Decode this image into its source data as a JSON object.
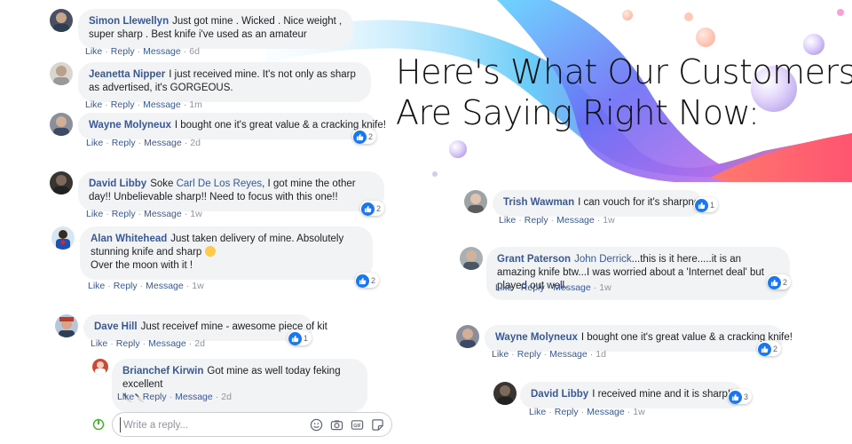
{
  "headline": {
    "line1": "Here's What Our Customers",
    "line2": "Are Saying Right Now:"
  },
  "comments": [
    {
      "name": "Simon Llewellyn",
      "text": "Just got mine . Wicked . Nice weight , super sharp . Best knife i've used as an amateur",
      "time": "6d",
      "reactions": ""
    },
    {
      "name": "Jeanetta Nipper",
      "text": "I just received mine. It's not only as sharp as advertised, it's GORGEOUS.",
      "time": "1m",
      "reactions": ""
    },
    {
      "name": "Wayne Molyneux",
      "text": "I bought one it's great value & a cracking knife!",
      "time": "2d",
      "reactions": "2"
    },
    {
      "name": "David Libby",
      "tag": "Carl De Los Reyes",
      "text_before": "Soke",
      "text": ", I got mine the other day!! Unbelievable sharp!! Need to focus with this one!!",
      "time": "1w",
      "reactions": "2"
    },
    {
      "name": "Alan Whitehead",
      "text": "Just taken delivery of mine. Absolutely stunning knife and sharp",
      "text2": "Over the moon with it !",
      "time": "1w",
      "reactions": "2"
    },
    {
      "name": "Dave Hill",
      "text": "Just receivef mine - awesome piece of kit",
      "time": "2d",
      "reactions": "1"
    },
    {
      "name": "Brianchef Kirwin",
      "text": "Got mine as well today feking excellent",
      "emoji": "🔪 🔪",
      "time": "2d",
      "reactions": ""
    },
    {
      "name": "Trish Wawman",
      "text": "I can vouch for it's sharpness.",
      "time": "1w",
      "reactions": "1"
    },
    {
      "name": "Grant Paterson",
      "tag": "John Derrick",
      "text": "...this is it here.....it is an amazing knife btw...I was worried about a 'Internet deal' but played out well.",
      "time": "1w",
      "reactions": "2"
    },
    {
      "name": "Wayne Molyneux",
      "text": "I bought one it's great value & a cracking knife!",
      "time": "1d",
      "reactions": "2"
    },
    {
      "name": "David Libby",
      "text": "I received mine and it is sharp!!",
      "time": "1w",
      "reactions": "3"
    }
  ],
  "actions": {
    "like": "Like",
    "reply": "Reply",
    "message": "Message",
    "sep": "·"
  },
  "reply_box": {
    "placeholder": "Write a reply..."
  },
  "colors": {
    "link": "#385898",
    "bubble": "#f2f3f5",
    "like": "#1877f2",
    "meta": "#90949c"
  }
}
